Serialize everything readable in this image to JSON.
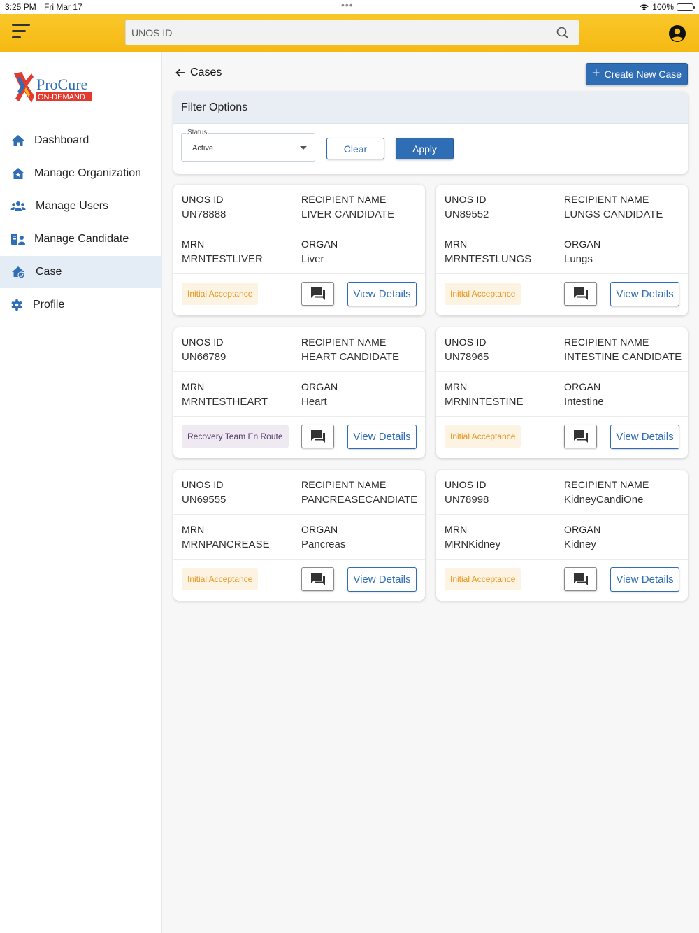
{
  "status_bar": {
    "time": "3:25 PM",
    "date": "Fri Mar 17",
    "battery": "100%"
  },
  "header": {
    "search_placeholder": "UNOS ID"
  },
  "logo": {
    "line1": "ProCure",
    "line2": "ON-DEMAND"
  },
  "sidebar": {
    "items": [
      {
        "label": "Dashboard",
        "icon": "home-icon"
      },
      {
        "label": "Manage Organization",
        "icon": "organization-icon"
      },
      {
        "label": "Manage Users",
        "icon": "users-icon"
      },
      {
        "label": "Manage Candidate",
        "icon": "candidate-icon"
      },
      {
        "label": "Case",
        "icon": "case-icon",
        "active": true
      },
      {
        "label": "Profile",
        "icon": "gear-icon"
      }
    ]
  },
  "main": {
    "title": "Cases",
    "create_label": "Create New Case",
    "filter": {
      "title": "Filter Options",
      "status_label": "Status",
      "status_value": "Active",
      "clear_label": "Clear",
      "apply_label": "Apply"
    },
    "labels": {
      "unos": "UNOS ID",
      "recipient": "RECIPIENT NAME",
      "mrn": "MRN",
      "organ": "ORGAN",
      "details": "View Details"
    },
    "cases": [
      {
        "unos_id": "UN78888",
        "recipient": "LIVER CANDIDATE",
        "mrn": "MRNTESTLIVER",
        "organ": "Liver",
        "status": "Initial Acceptance",
        "status_color": "#e8951a"
      },
      {
        "unos_id": "UN89552",
        "recipient": "LUNGS CANDIDATE",
        "mrn": "MRNTESTLUNGS",
        "organ": "Lungs",
        "status": "Initial Acceptance",
        "status_color": "#e8951a"
      },
      {
        "unos_id": "UN66789",
        "recipient": "HEART CANDIDATE",
        "mrn": "MRNTESTHEART",
        "organ": "Heart",
        "status": "Recovery Team En Route",
        "status_color": "#5a3d6e"
      },
      {
        "unos_id": "UN78965",
        "recipient": "INTESTINE CANDIDATE",
        "mrn": "MRNINTESTINE",
        "organ": "Intestine",
        "status": "Initial Acceptance",
        "status_color": "#e8951a"
      },
      {
        "unos_id": "UN69555",
        "recipient": "PANCREASECANDIATE",
        "mrn": "MRNPANCREASE",
        "organ": "Pancreas",
        "status": "Initial Acceptance",
        "status_color": "#e8951a"
      },
      {
        "unos_id": "UN78998",
        "recipient": "KidneyCandiOne",
        "mrn": "MRNKidney",
        "organ": "Kidney",
        "status": "Initial Acceptance",
        "status_color": "#e8951a"
      }
    ]
  },
  "colors": {
    "accent": "#2f6db5",
    "topbar": "#f6b913",
    "active_nav": "#e4ecf5"
  }
}
